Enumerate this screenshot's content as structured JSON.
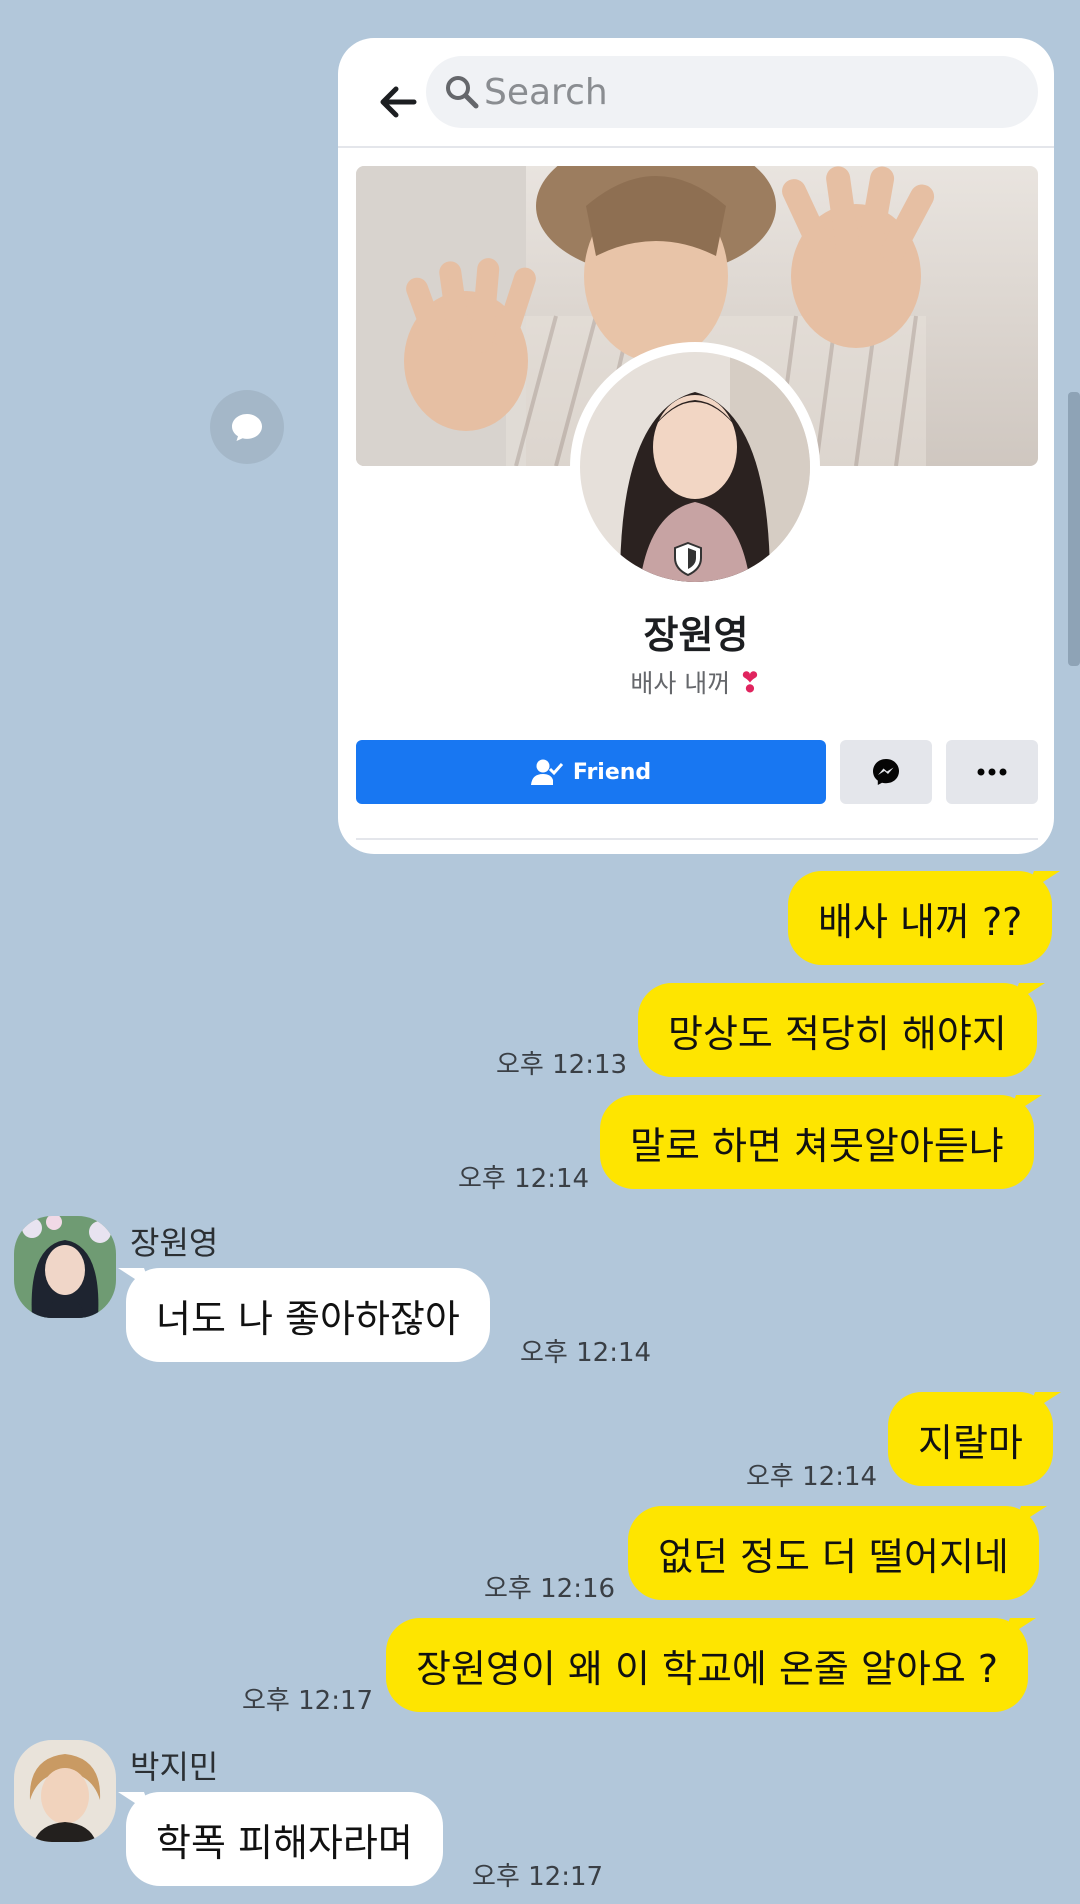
{
  "shared_card": {
    "search_placeholder": "Search",
    "profile_name": "장원영",
    "profile_bio": "배사 내꺼",
    "friend_label": "Friend"
  },
  "messages": [
    {
      "side": "me",
      "text": "배사 내꺼 ??",
      "time": ""
    },
    {
      "side": "me",
      "text": "망상도 적당히 해야지",
      "time": "오후 12:13"
    },
    {
      "side": "me",
      "text": "말로 하면 쳐못알아듣냐",
      "time": "오후 12:14"
    },
    {
      "side": "them",
      "sender": "장원영",
      "text": "너도 나 좋아하잖아",
      "time": "오후 12:14"
    },
    {
      "side": "me",
      "text": "지랄마",
      "time": "오후 12:14"
    },
    {
      "side": "me",
      "text": "없던 정도 더 떨어지네",
      "time": "오후 12:16"
    },
    {
      "side": "me",
      "text": "장원영이 왜 이 학교에 온줄 알아요 ?",
      "time": "오후 12:17"
    },
    {
      "side": "them",
      "sender": "박지민",
      "text": "학폭 피해자라며",
      "time": "오후 12:17"
    }
  ],
  "icons": {
    "back": "back-arrow-icon",
    "search": "search-icon",
    "friend": "friend-check-icon",
    "messenger": "messenger-icon",
    "more": "more-icon",
    "share": "speech-bubble-icon",
    "verified": "shield-icon"
  },
  "colors": {
    "chat_background": "#b2c7da",
    "my_bubble": "#fee500",
    "their_bubble": "#ffffff",
    "friend_button": "#1877f2"
  }
}
